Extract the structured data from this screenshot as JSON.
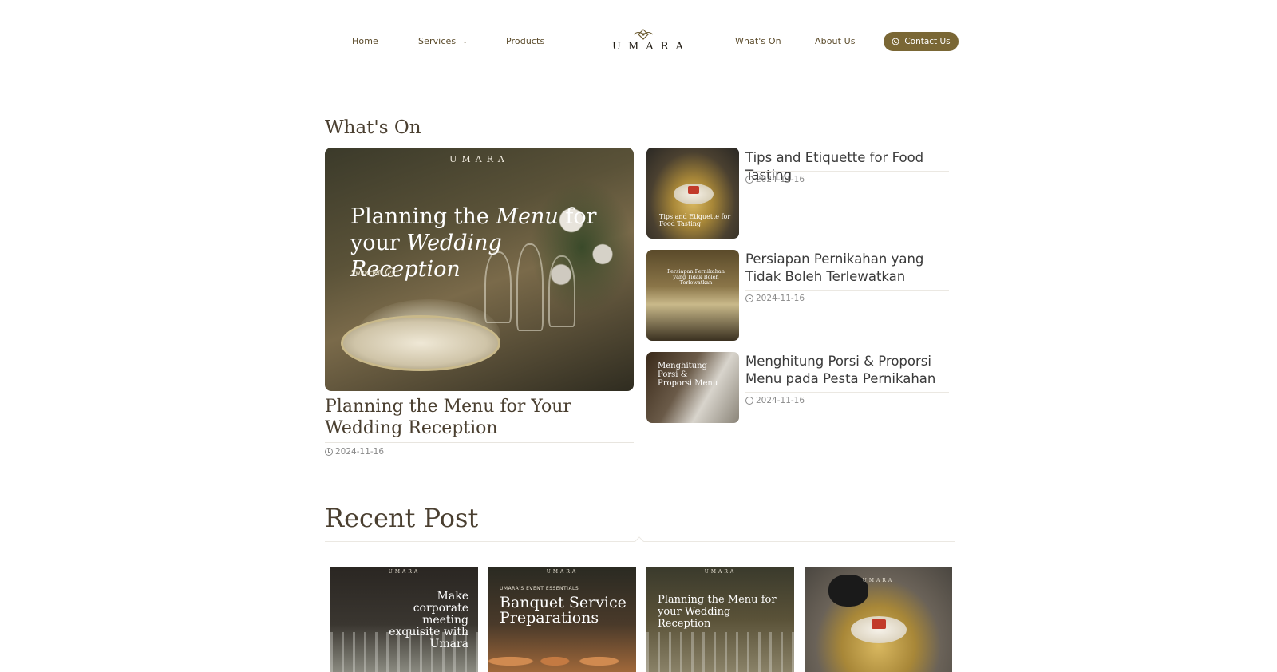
{
  "nav": {
    "home": "Home",
    "services": "Services",
    "products": "Products",
    "whats_on": "What's On",
    "about": "About Us",
    "contact": "Contact Us",
    "logo_text": "UMARA"
  },
  "whats_on": {
    "title": "What's On",
    "featured": {
      "image_brand": "UMARA",
      "image_heading_1": "Planning the ",
      "image_heading_2": "Menu",
      "image_heading_3": " for",
      "image_heading_4": "your ",
      "image_heading_5": "Wedding Reception",
      "image_swipe": "Swipe left",
      "title": "Planning the Menu for Your Wedding Reception",
      "date": "2024-11-16"
    },
    "articles": [
      {
        "title": "Tips and Etiquette for Food Tasting",
        "date": "2024-11-16",
        "image_text": "Tips and Etiquette for Food Tasting"
      },
      {
        "title": "Persiapan Pernikahan yang Tidak Boleh Terlewatkan",
        "date": "2024-11-16",
        "image_text": "Persiapan Pernikahan yang Tidak Boleh Terlewatkan"
      },
      {
        "title": "Menghitung Porsi & Proporsi Menu pada Pesta Pernikahan",
        "date": "2024-11-16",
        "image_text": "Menghitung Porsi & Proporsi Menu"
      }
    ]
  },
  "recent": {
    "title": "Recent Post",
    "cards": [
      {
        "brand": "UMARA",
        "text": "Make corporate meeting exquisite with Umara"
      },
      {
        "brand": "UMARA",
        "sub": "UMARA'S EVENT ESSENTIALS",
        "text": "Banquet Service Preparations"
      },
      {
        "brand": "UMARA",
        "text": "Planning the Menu for your Wedding Reception"
      },
      {
        "brand": "UMARA"
      }
    ]
  }
}
